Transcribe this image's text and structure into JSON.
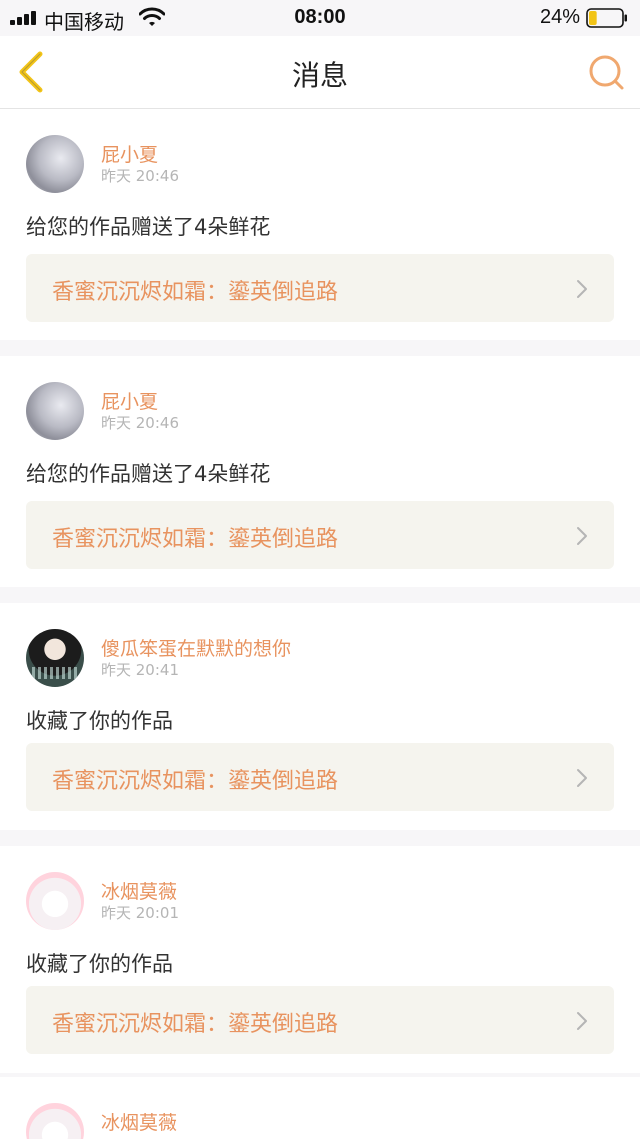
{
  "status_bar": {
    "carrier": "中国移动",
    "time": "08:00",
    "battery_percent": "24%",
    "battery_level": 0.24
  },
  "header": {
    "title": "消息",
    "back_icon": "chevron-left-icon",
    "search_icon": "search-icon"
  },
  "accent_color": "#e8935f",
  "messages": [
    {
      "user": "屁小夏",
      "time": "昨天 20:46",
      "text": "给您的作品赠送了4朵鲜花",
      "work": "香蜜沉沉烬如霜：鎏英倒追路"
    },
    {
      "user": "屁小夏",
      "time": "昨天 20:46",
      "text": "给您的作品赠送了4朵鲜花",
      "work": "香蜜沉沉烬如霜：鎏英倒追路"
    },
    {
      "user": "傻瓜笨蛋在默默的想你",
      "time": "昨天 20:41",
      "text": "收藏了你的作品",
      "work": "香蜜沉沉烬如霜：鎏英倒追路"
    },
    {
      "user": "冰烟莫薇",
      "time": "昨天 20:01",
      "text": "收藏了你的作品",
      "work": "香蜜沉沉烬如霜：鎏英倒追路"
    },
    {
      "user": "冰烟莫薇"
    }
  ]
}
